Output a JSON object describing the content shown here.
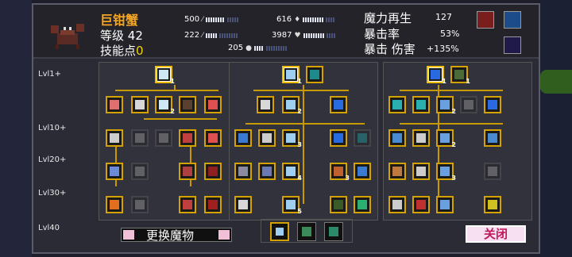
{
  "monster": {
    "name": "巨钳蟹",
    "level_label": "等级",
    "level": "42",
    "skill_label": "技能点",
    "skill_points": "0"
  },
  "stats": [
    {
      "name": "attack",
      "value": "500",
      "icon": "sword-icon"
    },
    {
      "name": "defense",
      "value": "222",
      "icon": "wand-icon"
    },
    {
      "name": "magic",
      "value": "616",
      "icon": "gem-icon"
    },
    {
      "name": "hp",
      "value": "3987",
      "icon": "heart-icon"
    },
    {
      "name": "speed",
      "value": "205",
      "icon": "shoe-icon"
    }
  ],
  "traits": [
    {
      "label": "魔力再生",
      "value": "127"
    },
    {
      "label": "暴击率",
      "value": "53%"
    },
    {
      "label": "暴击 伤害",
      "value": "+135%"
    }
  ],
  "level_rows": [
    "Lvl1+",
    "Lvl10+",
    "Lvl20+",
    "Lvl30+",
    "Lvl40"
  ],
  "node_counts": {
    "a1": "1",
    "a2": "2",
    "b1": "1",
    "b2": "2",
    "b3": "3",
    "b4": "3",
    "b5": "4",
    "b6": "5",
    "c1": "1",
    "c2": "1",
    "c3": "2",
    "c4": "2",
    "c5": "3"
  },
  "footer": {
    "switch_label": "更换魔物",
    "close_label": "关闭"
  },
  "colors": {
    "gold": "#d4a200",
    "accent_orange": "#f5a623",
    "close_text": "#c2185b"
  }
}
